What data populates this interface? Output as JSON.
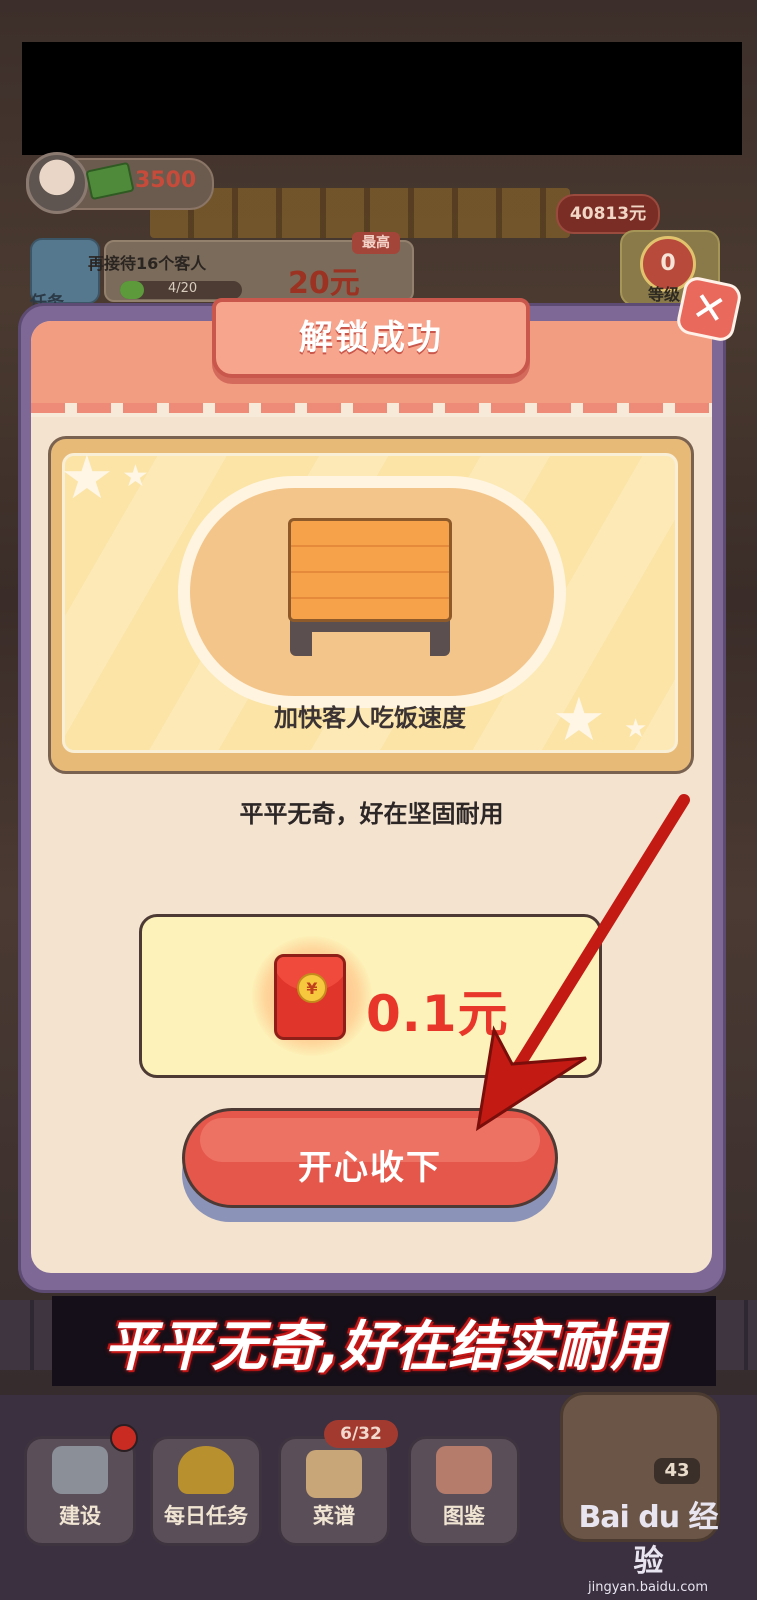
{
  "hud": {
    "coins": "3500",
    "money": "40813元",
    "task": {
      "text": "再接待16个客人",
      "progress": "4/20",
      "progress_fraction": 0.2,
      "reward": "20元",
      "badge": "最高",
      "label": "任务"
    },
    "right_count": "0",
    "right_label": "等级"
  },
  "modal": {
    "title": "解锁成功",
    "close_symbol": "✕",
    "feature_caption": "加快客人吃饭速度",
    "description": "平平无奇，好在坚固耐用",
    "reward_amount": "0.1元",
    "reward_coin_symbol": "¥",
    "claim_button": "开心收下"
  },
  "banner_caption": "平平无奇,好在结实耐用",
  "bottom_nav": {
    "items": [
      {
        "label": "建设",
        "icon": "hammer-icon"
      },
      {
        "label": "每日任务",
        "icon": "trophy-icon"
      },
      {
        "label": "菜谱",
        "icon": "recipe-book-icon"
      },
      {
        "label": "图鉴",
        "icon": "collection-cards-icon"
      }
    ],
    "recipe_badge": "6/32",
    "horn_count": "43"
  },
  "watermark": {
    "brand": "Bai du 经验",
    "url": "jingyan.baidu.com"
  },
  "colors": {
    "modal_frame": "#7e6996",
    "modal_body": "#f4e4cf",
    "accent_red": "#e4574a",
    "reward_red": "#e8372a"
  }
}
